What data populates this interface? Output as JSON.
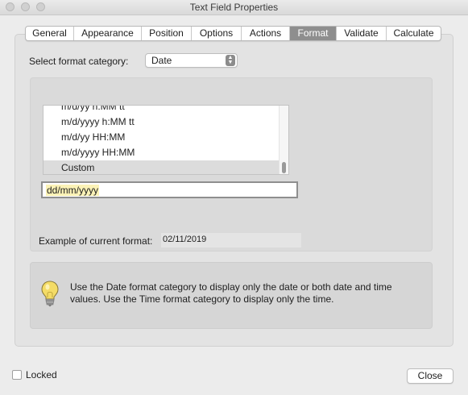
{
  "window": {
    "title": "Text Field Properties"
  },
  "tabs": [
    {
      "label": "General"
    },
    {
      "label": "Appearance"
    },
    {
      "label": "Position"
    },
    {
      "label": "Options"
    },
    {
      "label": "Actions"
    },
    {
      "label": "Format",
      "active": true
    },
    {
      "label": "Validate"
    },
    {
      "label": "Calculate"
    }
  ],
  "format": {
    "category_label": "Select format category:",
    "category_value": "Date",
    "list_items": [
      "m/d/yy h:MM tt",
      "m/d/yyyy h:MM tt",
      "m/d/yy HH:MM",
      "m/d/yyyy HH:MM",
      "Custom"
    ],
    "selected_item": "Custom",
    "custom_value": "dd/mm/yyyy",
    "example_label": "Example of current format:",
    "example_value": "02/11/2019"
  },
  "help": {
    "icon": "lightbulb-icon",
    "text": "Use the Date format category to display only the date or both date and time values. Use the Time format category to display only the time."
  },
  "footer": {
    "locked_label": "Locked",
    "locked_checked": false,
    "close_label": "Close"
  }
}
